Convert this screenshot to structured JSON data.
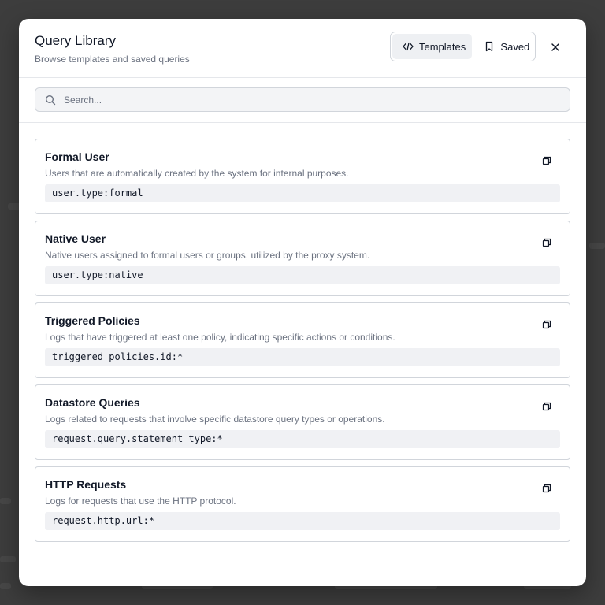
{
  "modal": {
    "title": "Query Library",
    "subtitle": "Browse templates and saved queries",
    "tabs": [
      {
        "label": "Templates",
        "icon": "code-icon",
        "active": true
      },
      {
        "label": "Saved",
        "icon": "bookmark-icon",
        "active": false
      }
    ],
    "close_icon": "close-icon"
  },
  "search": {
    "placeholder": "Search...",
    "value": ""
  },
  "templates": [
    {
      "title": "Formal User",
      "description": "Users that are automatically created by the system for internal purposes.",
      "query": "user.type:formal"
    },
    {
      "title": "Native User",
      "description": "Native users assigned to formal users or groups, utilized by the proxy system.",
      "query": "user.type:native"
    },
    {
      "title": "Triggered Policies",
      "description": "Logs that have triggered at least one policy, indicating specific actions or conditions.",
      "query": "triggered_policies.id:*"
    },
    {
      "title": "Datastore Queries",
      "description": "Logs related to requests that involve specific datastore query types or operations.",
      "query": "request.query.statement_type:*"
    },
    {
      "title": "HTTP Requests",
      "description": "Logs for requests that use the HTTP protocol.",
      "query": "request.http.url:*"
    }
  ],
  "colors": {
    "backdrop": "#3d3d3d",
    "active_tab": "#eef0f3",
    "code_bg": "#f0f1f4",
    "muted_text": "#6b7280"
  }
}
